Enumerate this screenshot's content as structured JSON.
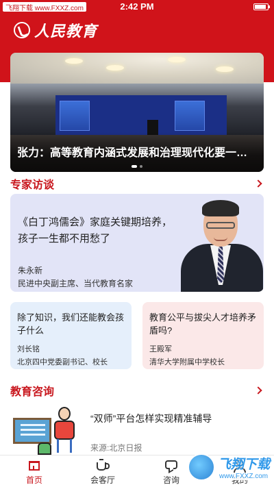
{
  "status_bar": {
    "carrier": "飞翔下载 www.FXXZ.com",
    "time": "2:42 PM"
  },
  "brand": {
    "name": "人民教育"
  },
  "hero": {
    "caption": "张力：高等教育内涵式发展和治理现代化要一体…"
  },
  "experts": {
    "section_title": "专家访谈",
    "featured": {
      "title": "《白丁鸿儒会》家庭关键期培养，孩子一生都不用愁了",
      "author": "朱永新",
      "role": "民进中央副主席、当代教育名家"
    },
    "cards": [
      {
        "title": "除了知识，我们还能教会孩子什么",
        "author": "刘长铭",
        "role": "北京四中党委副书记、校长"
      },
      {
        "title": "教育公平与拔尖人才培养矛盾吗?",
        "author": "王殿军",
        "role": "清华大学附属中学校长"
      }
    ]
  },
  "consulting": {
    "section_title": "教育咨询",
    "item": {
      "title": "“双师”平台怎样实现精准辅导",
      "source": "来源:北京日报"
    }
  },
  "tabbar": {
    "tabs": [
      {
        "label": "首页",
        "icon": "home-icon",
        "active": true
      },
      {
        "label": "会客厅",
        "icon": "cup-icon",
        "active": false
      },
      {
        "label": "咨询",
        "icon": "chat-icon",
        "active": false
      },
      {
        "label": "我的",
        "icon": "user-icon",
        "active": false
      }
    ]
  },
  "watermark": {
    "main": "飞翔下载",
    "sub": "www.FXXZ.com"
  },
  "colors": {
    "brand_red": "#c8161d",
    "header_red": "#d0131a",
    "feature_bg": "#e2e4f7",
    "card_blue": "#e5effb",
    "card_pink": "#fbe8e8"
  }
}
